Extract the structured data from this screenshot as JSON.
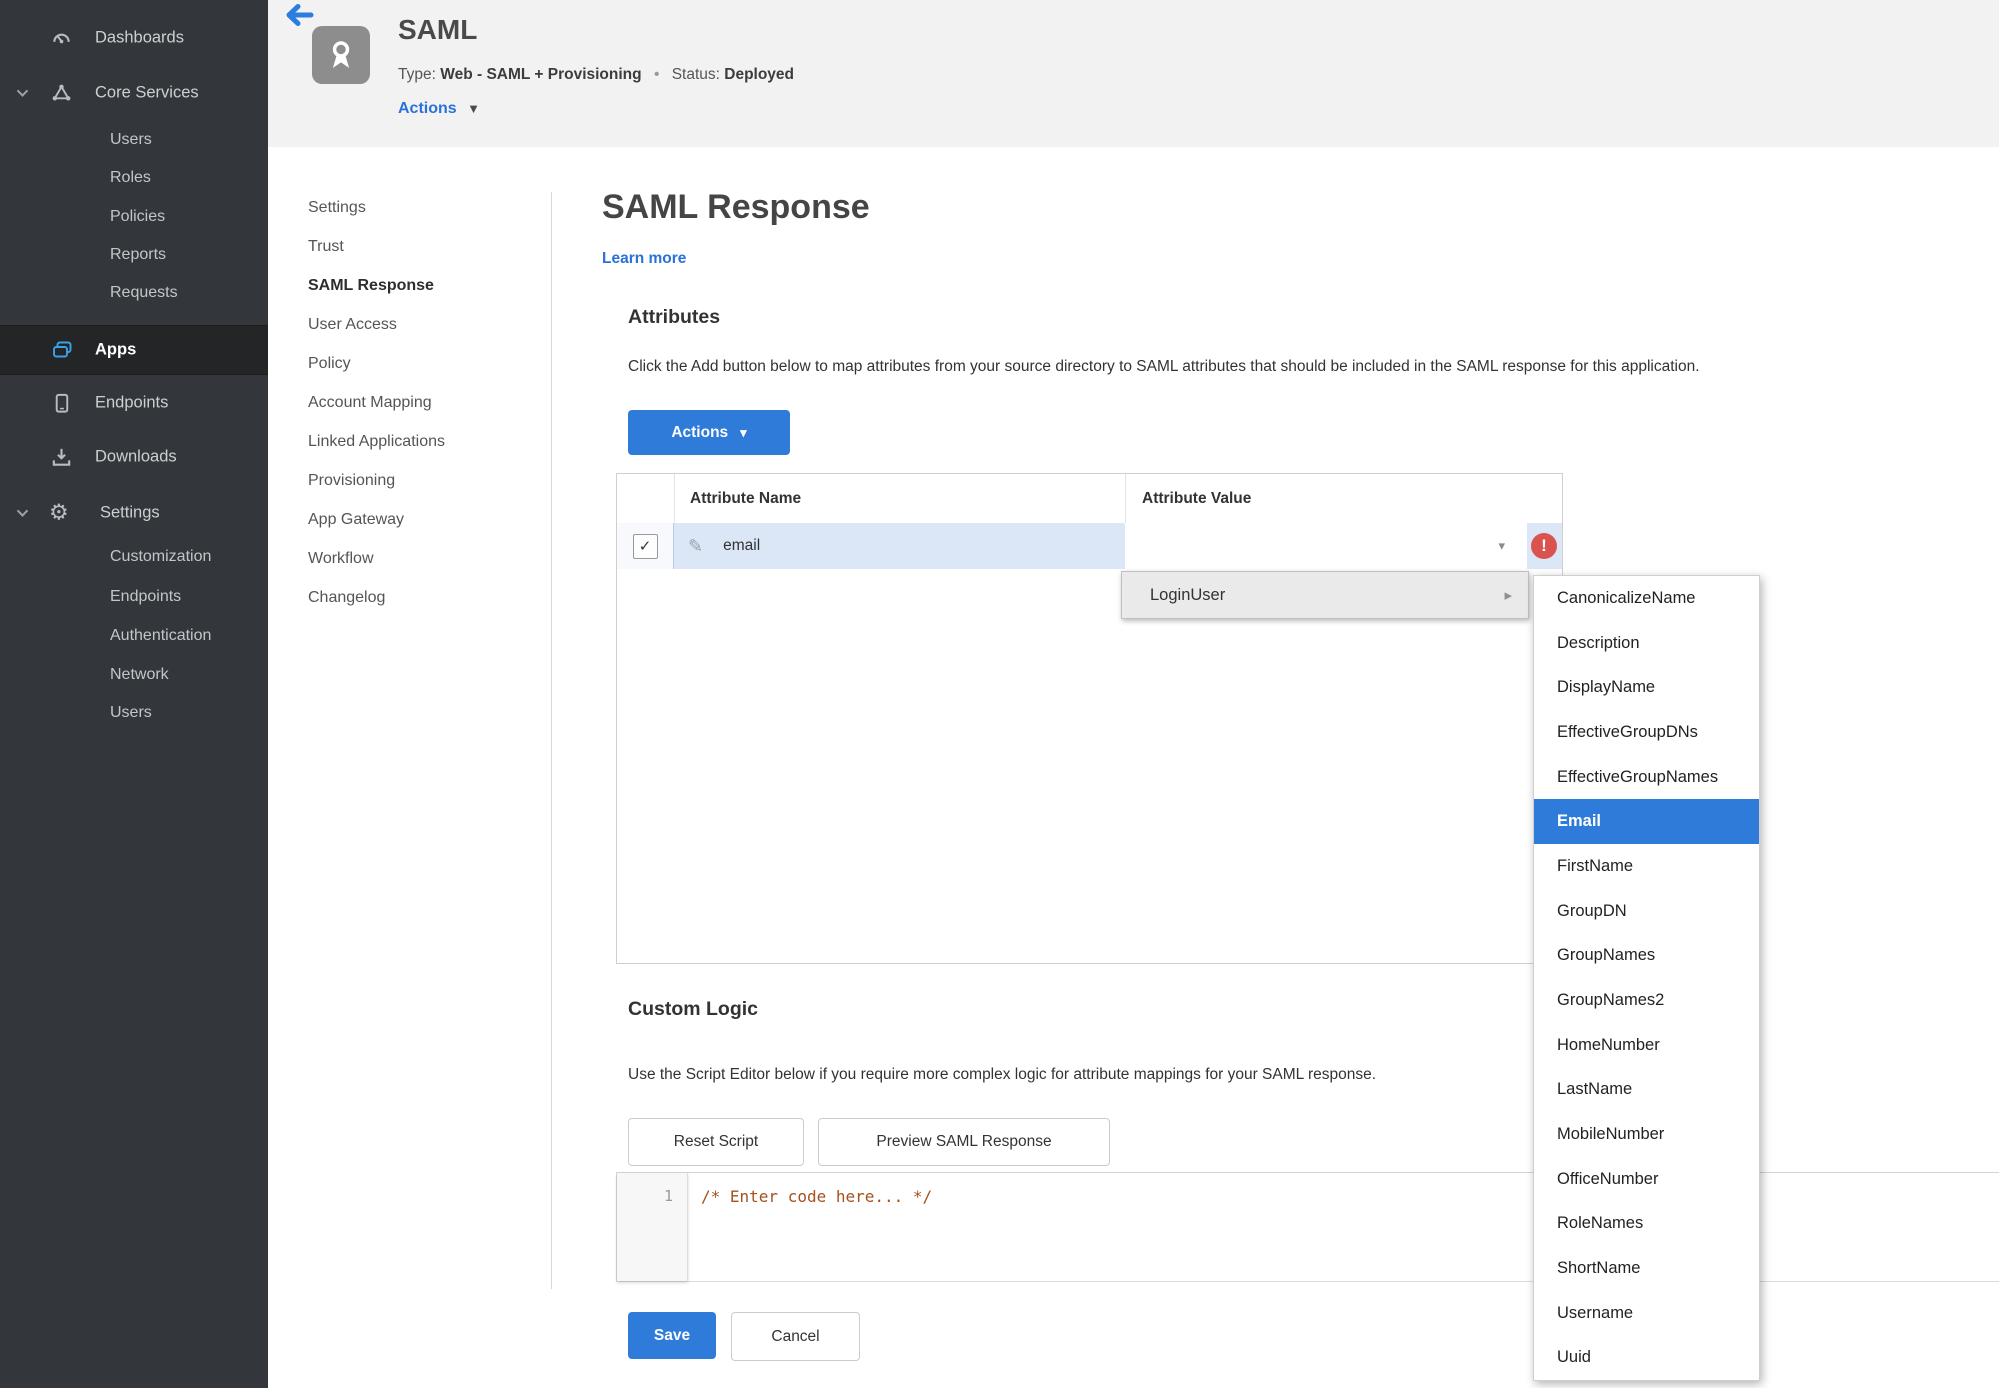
{
  "icons": {
    "caret_down": "▼",
    "caret_down_small": "▾",
    "caret_right": "▸",
    "check": "✓",
    "pencil": "✎",
    "gear": "⚙",
    "exclamation": "!"
  },
  "sidebar": {
    "dashboards_label": "Dashboards",
    "core_services_label": "Core Services",
    "core_items": [
      "Users",
      "Roles",
      "Policies",
      "Reports",
      "Requests"
    ],
    "apps_label": "Apps",
    "endpoints_label": "Endpoints",
    "downloads_label": "Downloads",
    "settings_label": "Settings",
    "settings_items": [
      "Customization",
      "Endpoints",
      "Authentication",
      "Network",
      "Users"
    ]
  },
  "header": {
    "app_title": "SAML",
    "type_label": "Type:",
    "type_value": "Web - SAML + Provisioning",
    "separator": "•",
    "status_label": "Status:",
    "status_value": "Deployed",
    "actions_label": "Actions"
  },
  "subnav": {
    "items": [
      "Settings",
      "Trust",
      "SAML Response",
      "User Access",
      "Policy",
      "Account Mapping",
      "Linked Applications",
      "Provisioning",
      "App Gateway",
      "Workflow",
      "Changelog"
    ],
    "active": "SAML Response"
  },
  "main": {
    "title": "SAML Response",
    "learn_more": "Learn more",
    "attributes": {
      "heading": "Attributes",
      "description": "Click the Add button below to map attributes from your source directory to SAML attributes that should be included in the SAML response for this application.",
      "actions_button": "Actions",
      "table": {
        "col_name": "Attribute Name",
        "col_value": "Attribute Value",
        "row": {
          "name": "email",
          "value": "",
          "checked": true,
          "error": true
        }
      }
    },
    "context_menu": {
      "label": "LoginUser",
      "items": [
        "CanonicalizeName",
        "Description",
        "DisplayName",
        "EffectiveGroupDNs",
        "EffectiveGroupNames",
        "Email",
        "FirstName",
        "GroupDN",
        "GroupNames",
        "GroupNames2",
        "HomeNumber",
        "LastName",
        "MobileNumber",
        "OfficeNumber",
        "RoleNames",
        "ShortName",
        "Username",
        "Uuid"
      ],
      "selected": "Email"
    },
    "custom_logic": {
      "heading": "Custom Logic",
      "description": "Use the Script Editor below if you require more complex logic for attribute mappings for your SAML response.",
      "reset_button": "Reset Script",
      "preview_button": "Preview SAML Response",
      "editor": {
        "line_number": "1",
        "code": "/* Enter code here... */"
      }
    },
    "save_button": "Save",
    "cancel_button": "Cancel"
  },
  "colors": {
    "accent_blue": "#2f7bd9",
    "link_blue": "#2a72d8",
    "status_green": "#3c8a28",
    "error_red": "#d9534f",
    "row_highlight": "#dbe7f7",
    "sidebar_bg": "#33373b",
    "apps_icon_blue": "#3aa2e8"
  }
}
